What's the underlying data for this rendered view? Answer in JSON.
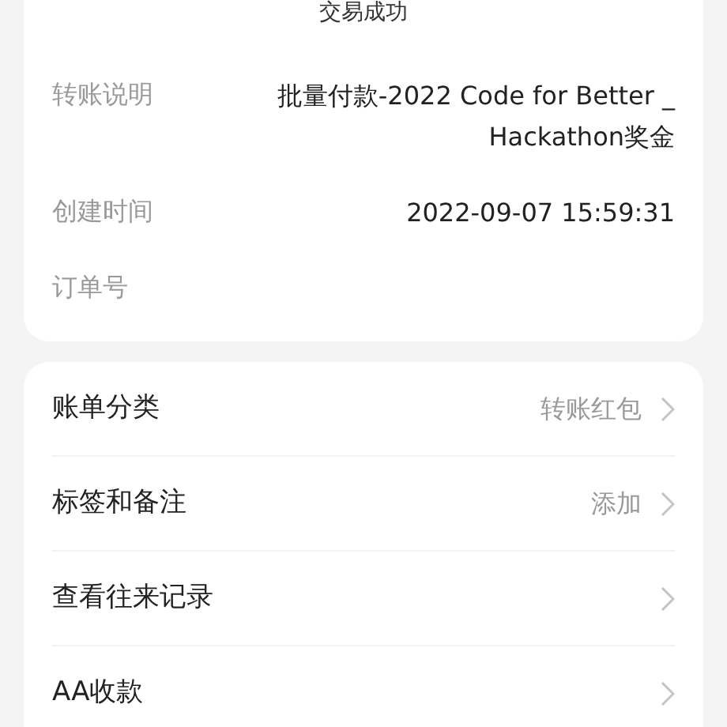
{
  "status": "交易成功",
  "details": [
    {
      "label": "转账说明",
      "value": "批量付款-2022 Code for Better _ Hackathon奖金"
    },
    {
      "label": "创建时间",
      "value": "2022-09-07 15:59:31"
    },
    {
      "label": "订单号"
    }
  ],
  "menu": [
    {
      "label": "账单分类",
      "value": "转账红包"
    },
    {
      "label": "标签和备注",
      "value": "添加"
    },
    {
      "label": "查看往来记录"
    },
    {
      "label": "AA收款"
    }
  ]
}
